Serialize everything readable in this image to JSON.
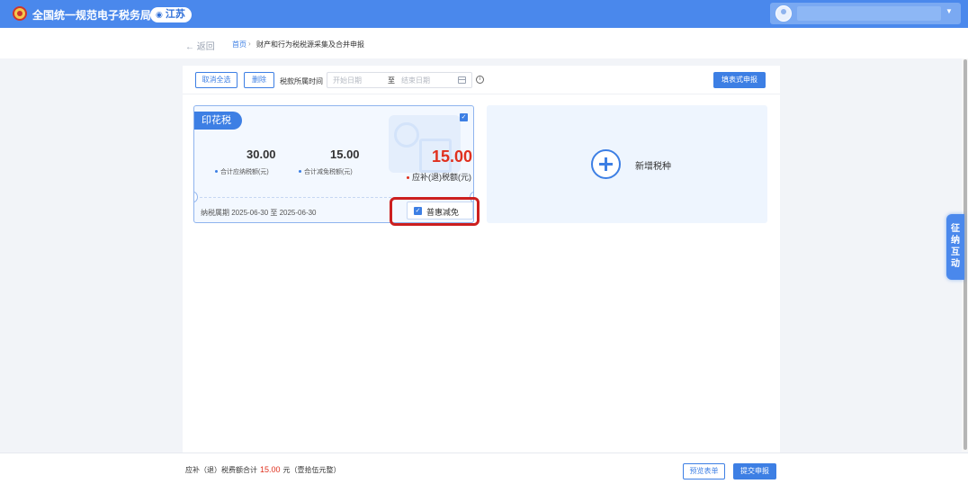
{
  "header": {
    "title": "全国统一规范电子税务局",
    "region": "江苏"
  },
  "breadcrumb": {
    "back": "← 返回",
    "home": "首页",
    "separator": "›",
    "current": "财产和行为税税源采集及合并申报"
  },
  "toolbar": {
    "deselect_all": "取消全选",
    "delete": "删除",
    "period_label": "税款所属时间",
    "start_placeholder": "开始日期",
    "range_separator": "至",
    "end_placeholder": "结束日期",
    "form_declare": "填表式申报"
  },
  "tax_card": {
    "name": "印花税",
    "total_payable": "30.00",
    "total_payable_label": "合计应纳税额(元)",
    "total_relief": "15.00",
    "total_relief_label": "合计减免税额(元)",
    "payable_refund": "15.00",
    "payable_refund_label": "应补(退)税额(元)",
    "period": "纳税属期 2025-06-30 至 2025-06-30",
    "preferential": "普惠减免",
    "checked": true
  },
  "add_card": {
    "label": "新增税种"
  },
  "float_tab": {
    "chars": [
      "征",
      "纳",
      "互",
      "动"
    ]
  },
  "footer": {
    "summary_prefix": "应补（退）税费额合计",
    "amount": "15.00",
    "summary_suffix": "元（壹拾伍元整）",
    "preview": "预览表单",
    "submit": "提交申报"
  },
  "colors": {
    "primary": "#3d7fe4",
    "header": "#4a88ec",
    "amount_red": "#e0301e",
    "highlight_red": "#cc1f1f"
  },
  "icons": [
    "emblem-icon",
    "location-pin-icon",
    "user-avatar-icon",
    "chevron-down-icon",
    "calendar-icon",
    "info-icon",
    "checkbox-checked-icon",
    "plus-circle-icon"
  ]
}
